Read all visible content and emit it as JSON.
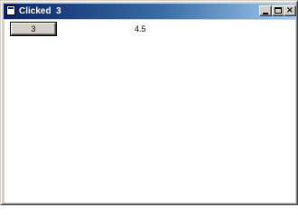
{
  "window": {
    "title": "Clicked  3",
    "icon": "app-window-icon",
    "controls": {
      "minimize_icon": "minimize-icon",
      "maximize_icon": "maximize-icon",
      "close_icon": "close-icon"
    }
  },
  "content": {
    "button_label": "3",
    "value_text": "4.5"
  },
  "colors": {
    "titlebar_start": "#0a246a",
    "titlebar_end": "#a6caf0",
    "face": "#d4d0c8",
    "client_background": "#ffffff"
  }
}
